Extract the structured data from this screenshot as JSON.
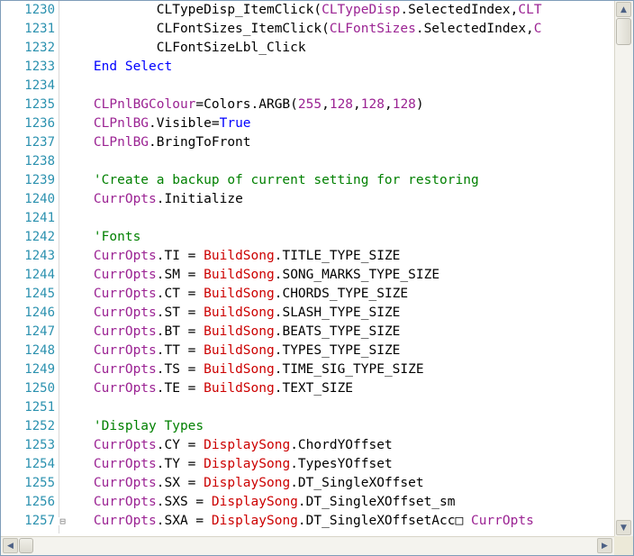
{
  "colors": {
    "keyword": "#0000ff",
    "variable": "#9b2393",
    "object": "#cc0000",
    "comment": "#008000",
    "number": "#9b2393",
    "line_number": "#2b91af"
  },
  "editor": {
    "lines": [
      {
        "num": "1230",
        "tokens": [
          {
            "t": "            CLTypeDisp_ItemClick(",
            "c": "plain"
          },
          {
            "t": "CLTypeDisp",
            "c": "variable"
          },
          {
            "t": ".SelectedIndex,",
            "c": "plain"
          },
          {
            "t": "CLT",
            "c": "variable"
          }
        ]
      },
      {
        "num": "1231",
        "tokens": [
          {
            "t": "            CLFontSizes_ItemClick(",
            "c": "plain"
          },
          {
            "t": "CLFontSizes",
            "c": "variable"
          },
          {
            "t": ".SelectedIndex,",
            "c": "plain"
          },
          {
            "t": "C",
            "c": "variable"
          }
        ]
      },
      {
        "num": "1232",
        "tokens": [
          {
            "t": "            CLFontSizeLbl_Click",
            "c": "plain"
          }
        ]
      },
      {
        "num": "1233",
        "tokens": [
          {
            "t": "    End Select",
            "c": "keyword"
          }
        ]
      },
      {
        "num": "1234",
        "tokens": []
      },
      {
        "num": "1235",
        "tokens": [
          {
            "t": "    CLPnlBGColour",
            "c": "variable"
          },
          {
            "t": "=Colors.ARGB(",
            "c": "plain"
          },
          {
            "t": "255",
            "c": "number"
          },
          {
            "t": ",",
            "c": "plain"
          },
          {
            "t": "128",
            "c": "number"
          },
          {
            "t": ",",
            "c": "plain"
          },
          {
            "t": "128",
            "c": "number"
          },
          {
            "t": ",",
            "c": "plain"
          },
          {
            "t": "128",
            "c": "number"
          },
          {
            "t": ")",
            "c": "plain"
          }
        ]
      },
      {
        "num": "1236",
        "tokens": [
          {
            "t": "    CLPnlBG",
            "c": "variable"
          },
          {
            "t": ".Visible=",
            "c": "plain"
          },
          {
            "t": "True",
            "c": "keyword"
          }
        ]
      },
      {
        "num": "1237",
        "tokens": [
          {
            "t": "    CLPnlBG",
            "c": "variable"
          },
          {
            "t": ".BringToFront",
            "c": "plain"
          }
        ]
      },
      {
        "num": "1238",
        "tokens": []
      },
      {
        "num": "1239",
        "tokens": [
          {
            "t": "    'Create a backup of current setting for restoring",
            "c": "comment"
          }
        ]
      },
      {
        "num": "1240",
        "tokens": [
          {
            "t": "    CurrOpts",
            "c": "variable"
          },
          {
            "t": ".Initialize",
            "c": "plain"
          }
        ]
      },
      {
        "num": "1241",
        "tokens": []
      },
      {
        "num": "1242",
        "tokens": [
          {
            "t": "    'Fonts",
            "c": "comment"
          }
        ]
      },
      {
        "num": "1243",
        "tokens": [
          {
            "t": "    CurrOpts",
            "c": "variable"
          },
          {
            "t": ".TI = ",
            "c": "plain"
          },
          {
            "t": "BuildSong",
            "c": "object"
          },
          {
            "t": ".TITLE_TYPE_SIZE",
            "c": "plain"
          }
        ]
      },
      {
        "num": "1244",
        "tokens": [
          {
            "t": "    CurrOpts",
            "c": "variable"
          },
          {
            "t": ".SM = ",
            "c": "plain"
          },
          {
            "t": "BuildSong",
            "c": "object"
          },
          {
            "t": ".SONG_MARKS_TYPE_SIZE",
            "c": "plain"
          }
        ]
      },
      {
        "num": "1245",
        "tokens": [
          {
            "t": "    CurrOpts",
            "c": "variable"
          },
          {
            "t": ".CT = ",
            "c": "plain"
          },
          {
            "t": "BuildSong",
            "c": "object"
          },
          {
            "t": ".CHORDS_TYPE_SIZE",
            "c": "plain"
          }
        ]
      },
      {
        "num": "1246",
        "tokens": [
          {
            "t": "    CurrOpts",
            "c": "variable"
          },
          {
            "t": ".ST = ",
            "c": "plain"
          },
          {
            "t": "BuildSong",
            "c": "object"
          },
          {
            "t": ".SLASH_TYPE_SIZE",
            "c": "plain"
          }
        ]
      },
      {
        "num": "1247",
        "tokens": [
          {
            "t": "    CurrOpts",
            "c": "variable"
          },
          {
            "t": ".BT = ",
            "c": "plain"
          },
          {
            "t": "BuildSong",
            "c": "object"
          },
          {
            "t": ".BEATS_TYPE_SIZE",
            "c": "plain"
          }
        ]
      },
      {
        "num": "1248",
        "tokens": [
          {
            "t": "    CurrOpts",
            "c": "variable"
          },
          {
            "t": ".TT = ",
            "c": "plain"
          },
          {
            "t": "BuildSong",
            "c": "object"
          },
          {
            "t": ".TYPES_TYPE_SIZE",
            "c": "plain"
          }
        ]
      },
      {
        "num": "1249",
        "tokens": [
          {
            "t": "    CurrOpts",
            "c": "variable"
          },
          {
            "t": ".TS = ",
            "c": "plain"
          },
          {
            "t": "BuildSong",
            "c": "object"
          },
          {
            "t": ".TIME_SIG_TYPE_SIZE",
            "c": "plain"
          }
        ]
      },
      {
        "num": "1250",
        "tokens": [
          {
            "t": "    CurrOpts",
            "c": "variable"
          },
          {
            "t": ".TE = ",
            "c": "plain"
          },
          {
            "t": "BuildSong",
            "c": "object"
          },
          {
            "t": ".TEXT_SIZE",
            "c": "plain"
          }
        ]
      },
      {
        "num": "1251",
        "tokens": []
      },
      {
        "num": "1252",
        "tokens": [
          {
            "t": "    'Display Types",
            "c": "comment"
          }
        ]
      },
      {
        "num": "1253",
        "tokens": [
          {
            "t": "    CurrOpts",
            "c": "variable"
          },
          {
            "t": ".CY = ",
            "c": "plain"
          },
          {
            "t": "DisplaySong",
            "c": "object"
          },
          {
            "t": ".ChordYOffset",
            "c": "plain"
          }
        ]
      },
      {
        "num": "1254",
        "tokens": [
          {
            "t": "    CurrOpts",
            "c": "variable"
          },
          {
            "t": ".TY = ",
            "c": "plain"
          },
          {
            "t": "DisplaySong",
            "c": "object"
          },
          {
            "t": ".TypesYOffset",
            "c": "plain"
          }
        ]
      },
      {
        "num": "1255",
        "tokens": [
          {
            "t": "    CurrOpts",
            "c": "variable"
          },
          {
            "t": ".SX = ",
            "c": "plain"
          },
          {
            "t": "DisplaySong",
            "c": "object"
          },
          {
            "t": ".DT_SingleXOffset",
            "c": "plain"
          }
        ]
      },
      {
        "num": "1256",
        "tokens": [
          {
            "t": "    CurrOpts",
            "c": "variable"
          },
          {
            "t": ".SXS = ",
            "c": "plain"
          },
          {
            "t": "DisplaySong",
            "c": "object"
          },
          {
            "t": ".DT_SingleXOffset_sm",
            "c": "plain"
          }
        ]
      },
      {
        "num": "1257",
        "tokens": [
          {
            "t": "    CurrOpts",
            "c": "variable"
          },
          {
            "t": ".SXA = ",
            "c": "plain"
          },
          {
            "t": "DisplaySong",
            "c": "object"
          },
          {
            "t": ".DT_SingleXOffsetAcc□ ",
            "c": "plain"
          },
          {
            "t": "CurrOpts",
            "c": "variable"
          }
        ]
      }
    ],
    "fold_line": "1257",
    "fold_symbol": "⊟"
  },
  "scrollbars": {
    "up_arrow": "▲",
    "down_arrow": "▼",
    "left_arrow": "◀",
    "right_arrow": "▶"
  }
}
